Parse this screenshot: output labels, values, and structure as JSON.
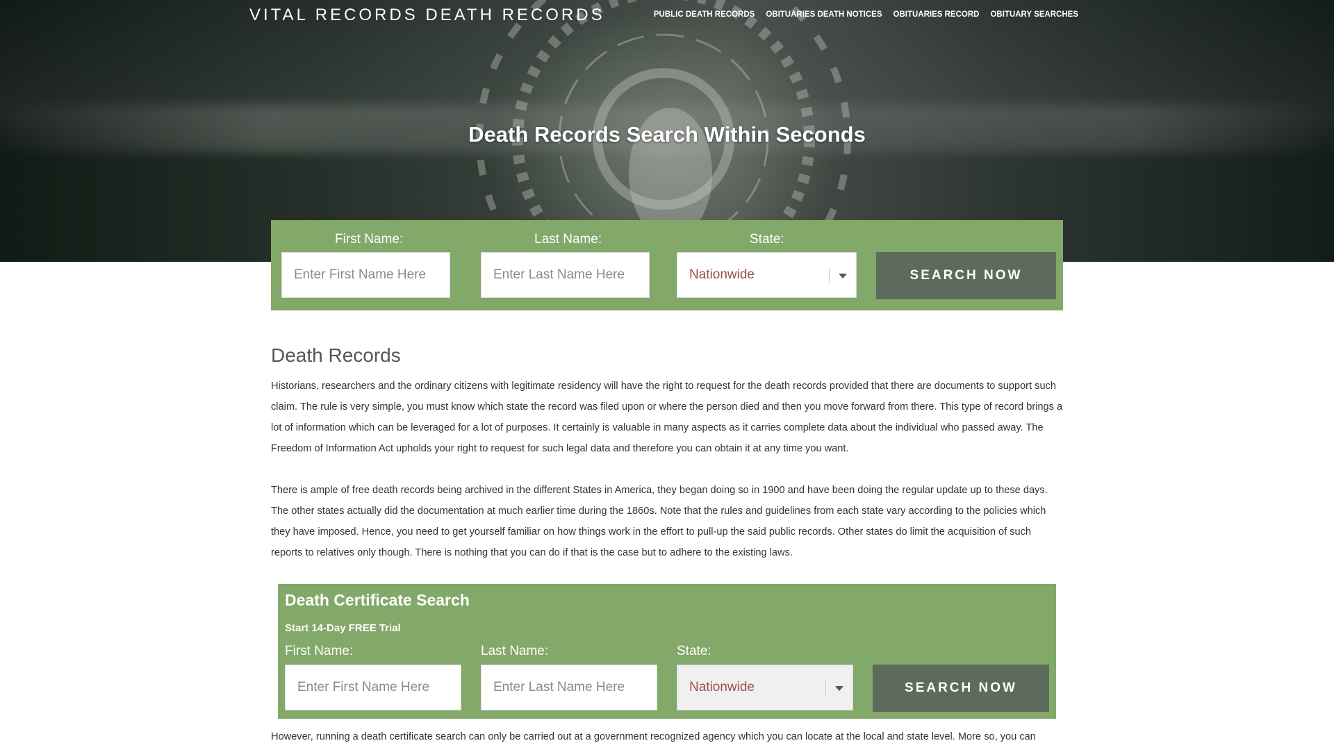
{
  "brand": "VITAL RECORDS DEATH RECORDS",
  "nav": [
    "PUBLIC DEATH RECORDS",
    "OBITUARIES DEATH NOTICES",
    "OBITUARIES RECORD",
    "OBITUARY SEARCHES"
  ],
  "hero": {
    "title": "Death Records Search Within Seconds"
  },
  "top_search": {
    "first_label": "First Name:",
    "first_placeholder": "Enter First Name Here",
    "last_label": "Last Name:",
    "last_placeholder": "Enter Last Name Here",
    "state_label": "State:",
    "state_value": "Nationwide",
    "button": "SEARCH NOW"
  },
  "content": {
    "title": "Death Records",
    "paragraphs": [
      "Historians, researchers and the ordinary citizens with legitimate residency will have the right to request for the death records provided that there are documents to support such claim. The rule is very simple, you must know which state the record was filed upon or where the person died and then you move forward from there. This type of record brings a lot of information which can be leveraged for a lot of purposes. It certainly is valuable in many aspects as it carries complete data about the individual who passed away. The Freedom of Information Act upholds your right to request for such legal data and therefore you can obtain it at any time you want.",
      "There is ample of free death records being archived in the different States in America, they began doing so in 1900 and have been doing the regular update up to these days. The other states actually did the documentation at much earlier time during the 1860s. Note that the rules and guidelines from each state vary according to the policies which they have imposed. Hence, you need to get yourself familiar on how things work in the effort to pull-up the said public records. Other states do limit the acquisition of such reports to relatives only though. There is nothing that you can do if that is the case but to adhere to the existing laws.",
      "However, running a death certificate search can only be carried out at a government recognized agency which you can locate at the local and state level. More so, you can"
    ]
  },
  "cert_search": {
    "heading": "Death Certificate Search",
    "trial": "Start 14-Day FREE Trial",
    "first_label": "First Name:",
    "first_placeholder": "Enter First Name Here",
    "last_label": "Last Name:",
    "last_placeholder": "Enter Last Name Here",
    "state_label": "State:",
    "state_value": "Nationwide",
    "button": "SEARCH NOW"
  },
  "colors": {
    "form_green": "#82a86a",
    "button_gray": "#5d6b5c",
    "select_text": "#9c5050"
  }
}
